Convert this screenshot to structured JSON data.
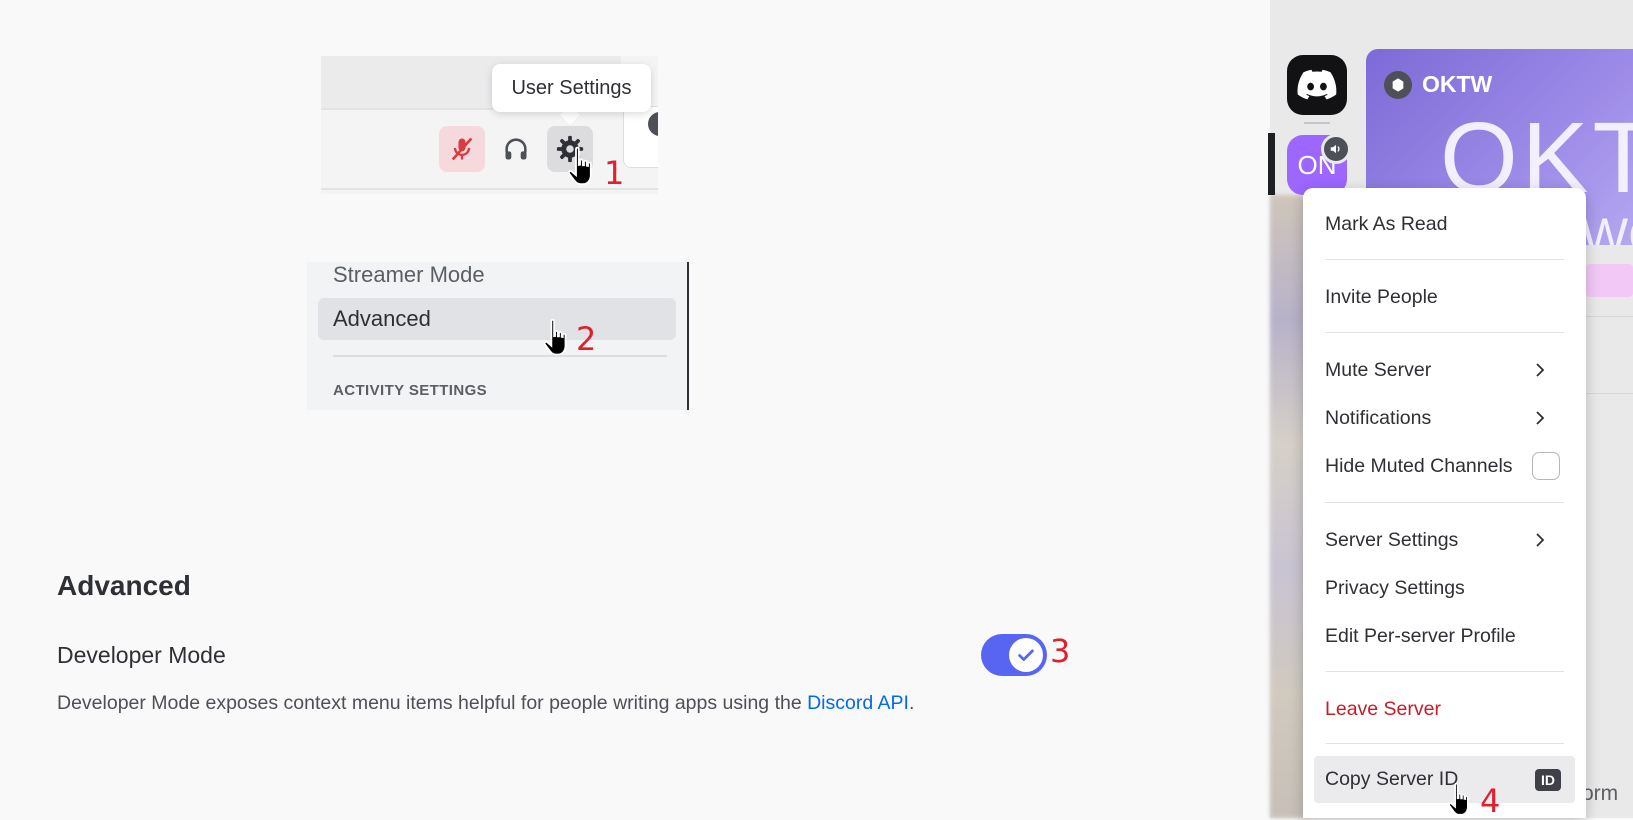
{
  "step1": {
    "tooltip": "User Settings",
    "step_number": "1"
  },
  "step2": {
    "streamer_mode": "Streamer Mode",
    "advanced": "Advanced",
    "activity_settings": "ACTIVITY SETTINGS",
    "step_number": "2"
  },
  "advanced_section": {
    "heading": "Advanced",
    "developer_mode_label": "Developer Mode",
    "description_prefix": "Developer Mode exposes context menu items helpful for people writing apps using the ",
    "description_link": "Discord API",
    "description_suffix": ".",
    "toggle_on": true,
    "step_number": "3"
  },
  "server_rail": {
    "server_icon_text": "ON"
  },
  "banner": {
    "title": "OKTW",
    "big_text": "OKT",
    "second_line": "WO"
  },
  "context_menu": {
    "mark_as_read": "Mark As Read",
    "invite_people": "Invite People",
    "mute_server": "Mute Server",
    "notifications": "Notifications",
    "hide_muted_channels": "Hide Muted Channels",
    "server_settings": "Server Settings",
    "privacy_settings": "Privacy Settings",
    "edit_profile": "Edit Per-server Profile",
    "leave_server": "Leave Server",
    "copy_server_id": "Copy Server ID",
    "id_badge": "ID",
    "step_number": "4"
  },
  "background_text": {
    "partial": "orm"
  },
  "colors": {
    "accent": "#5865f2",
    "danger": "#c41e27",
    "link": "#006ce7",
    "step_marker": "#e0202f"
  }
}
